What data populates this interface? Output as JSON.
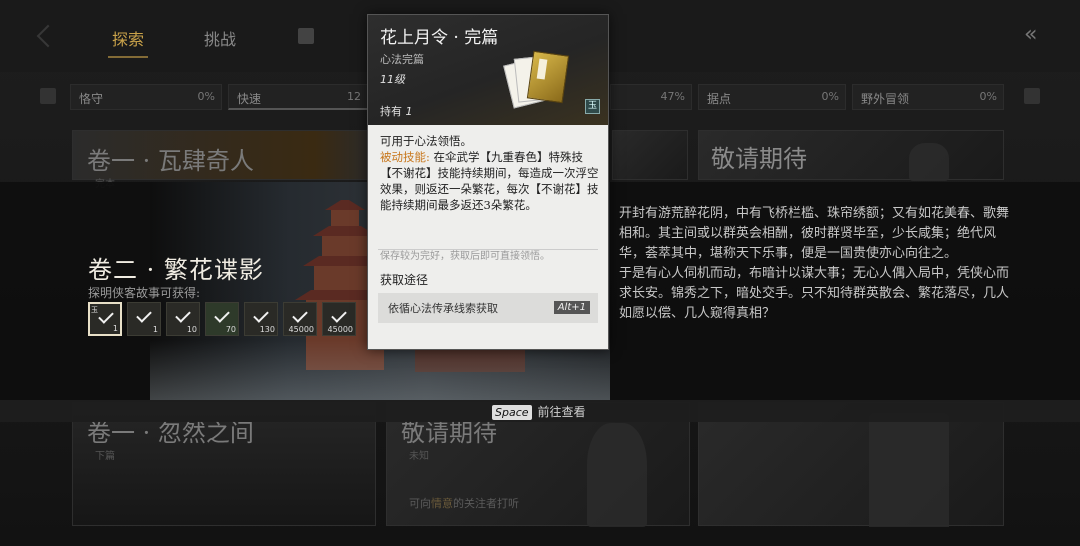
{
  "tabs": {
    "explore": "探索",
    "challenge": "挑战"
  },
  "filters": [
    {
      "label": "恪守",
      "value": "0%"
    },
    {
      "label": "快速",
      "value": "12"
    },
    {
      "label": "",
      "value": "47%"
    },
    {
      "label": "据点",
      "value": "0%"
    },
    {
      "label": "野外冒领",
      "value": "0%"
    }
  ],
  "cards": {
    "chapter1": {
      "title": "卷一 · 瓦肆奇人",
      "sub": "完本"
    },
    "coming1": {
      "title": "敬请期待"
    },
    "chapter3": {
      "title": "卷一 · 忽然之间",
      "sub": "下篇"
    },
    "coming2": {
      "title": "敬请期待",
      "sub": "未知",
      "body_pre": "可向",
      "body_hl": "情意",
      "body_post": "的关注者打听"
    }
  },
  "featured": {
    "title": "卷二 · 繁花谍影",
    "subtitle": "探明侠客故事可获得:",
    "rewards": [
      {
        "count": "1",
        "tag": "玉"
      },
      {
        "count": "1"
      },
      {
        "count": "10"
      },
      {
        "count": "70"
      },
      {
        "count": "130"
      },
      {
        "count": "45000"
      },
      {
        "count": "45000"
      }
    ],
    "description": [
      "开封有游荒醉花阴，中有飞桥栏槛、珠帘绣额；又有如花美春、歌舞相和。其主间或以群英会相酬，彼时群贤毕至，少长咸集；绝代风华，荟萃其中，堪称天下乐事，便是一国贵使亦心向往之。",
      "于是有心人伺机而动，布暗计以谋大事；无心人偶入局中，凭侠心而求长安。锦秀之下，暗处交手。只不知待群英散会、繁花落尽，几人如愿以偿、几人窥得真相？"
    ]
  },
  "hint": {
    "key": "Space",
    "text": "前往查看"
  },
  "tooltip": {
    "title": "花上月令 · 完篇",
    "type": "心法完篇",
    "level": "11级",
    "owned_label": "持有",
    "owned_value": "1",
    "badge": "玉",
    "use": "可用于心法领悟。",
    "skill_label": "被动技能:",
    "skill_text": "在伞武学【九重春色】特殊技【不谢花】技能持续期间，每造成一次浮空效果，则返还一朵繁花，每次【不谢花】技能持续期间最多返还3朵繁花。",
    "note": "保存较为完好，获取后即可直接领悟。",
    "source_heading": "获取途径",
    "source_text": "依循心法传承线索获取",
    "source_key": "Alt+1"
  }
}
